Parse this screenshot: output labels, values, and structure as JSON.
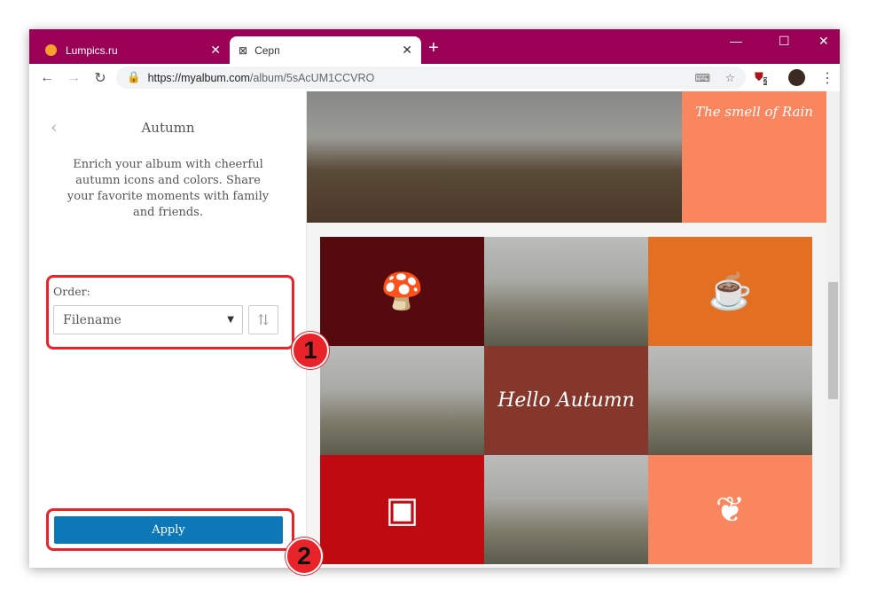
{
  "browser": {
    "tabs": [
      {
        "label": "Lumpics.ru"
      },
      {
        "label": "Серп"
      }
    ],
    "url_host": "https://myalbum.com",
    "url_path": "/album/5sAcUM1CCVRO",
    "extension_badge": "2"
  },
  "panel": {
    "title": "Autumn",
    "description": "Enrich your album with cheerful autumn icons and colors. Share your favorite moments with family and friends.",
    "order_label": "Order:",
    "order_value": "Filename",
    "apply_label": "Apply"
  },
  "gallery": {
    "top_text": "The smell of Rain",
    "cells": [
      {
        "type": "icon",
        "icon": "mushroom-icon",
        "color": "#570a0e"
      },
      {
        "type": "photo"
      },
      {
        "type": "icon",
        "icon": "mug-icon",
        "color": "#e36f23"
      },
      {
        "type": "photo"
      },
      {
        "type": "text",
        "text": "Hello Autumn",
        "color": "#86372b"
      },
      {
        "type": "photo"
      },
      {
        "type": "icon",
        "icon": "jar-icon",
        "color": "#c00a12"
      },
      {
        "type": "photo"
      },
      {
        "type": "icon",
        "icon": "leaf-icon",
        "color": "#fa8660"
      }
    ]
  },
  "annotations": [
    "1",
    "2"
  ],
  "colors": {
    "accent": "#0c78b7",
    "chrome": "#9b0057",
    "highlight": "#e8242a"
  }
}
